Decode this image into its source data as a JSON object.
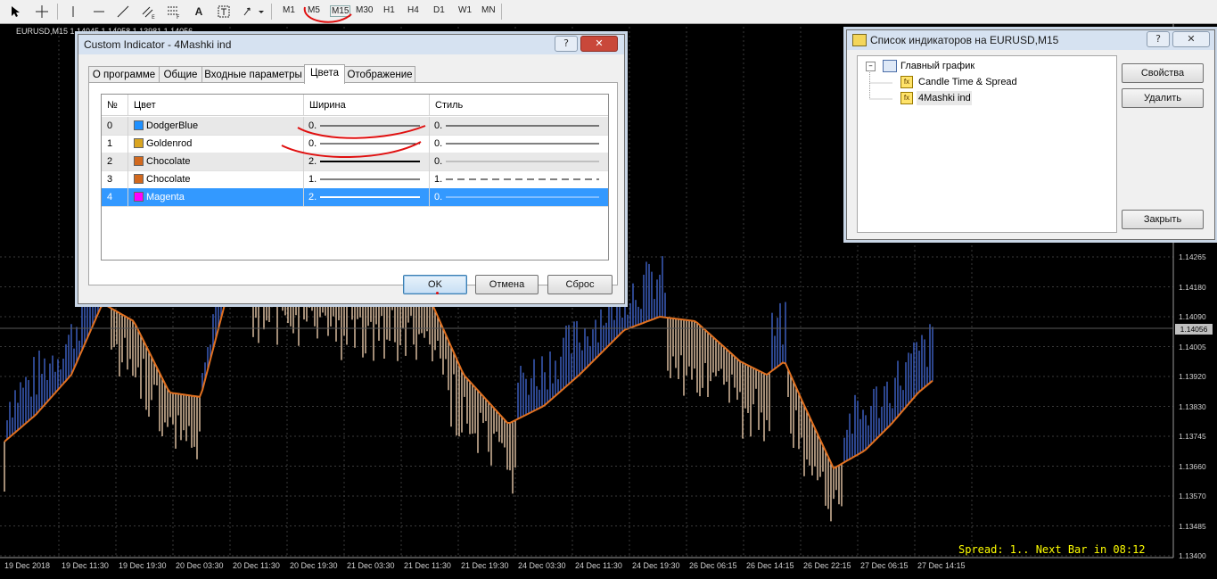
{
  "toolbar": {
    "timeframes": [
      "M1",
      "M5",
      "M15",
      "M30",
      "H1",
      "H4",
      "D1",
      "W1",
      "MN"
    ]
  },
  "chart": {
    "symbol_label": "EURUSD,M15  1.14045 1.14058 1.13981 1.14056",
    "price_ticks": [
      "1.14265",
      "1.14180",
      "1.14090",
      "1.14005",
      "1.13920",
      "1.13830",
      "1.13745",
      "1.13660",
      "1.13570",
      "1.13485",
      "1.13400"
    ],
    "current_price": "1.14056",
    "time_ticks": [
      "19 Dec 2018",
      "19 Dec 11:30",
      "19 Dec 19:30",
      "20 Dec 03:30",
      "20 Dec 11:30",
      "20 Dec 19:30",
      "21 Dec 03:30",
      "21 Dec 11:30",
      "21 Dec 19:30",
      "24 Dec 03:30",
      "24 Dec 11:30",
      "24 Dec 19:30",
      "26 Dec 06:15",
      "26 Dec 14:15",
      "26 Dec 22:15",
      "27 Dec 06:15",
      "27 Dec 14:15"
    ],
    "spread_text": "Spread: 1.. Next Bar in 08:12",
    "colors": {
      "up_bar": "#3f63c8",
      "down_bar": "#e8c9a8",
      "ma_line": "#e07020",
      "grid": "#3a3a3a"
    }
  },
  "indicator_dialog": {
    "title": "Custom Indicator - 4Mashki ind",
    "help_btn": "?",
    "tabs": [
      "О программе",
      "Общие",
      "Входные параметры",
      "Цвета",
      "Отображение"
    ],
    "active_tab": "Цвета",
    "columns": [
      "№",
      "Цвет",
      "Ширина",
      "Стиль"
    ],
    "rows": [
      {
        "num": "0",
        "color_name": "DodgerBlue",
        "color": "#1e90ff",
        "width": "0.",
        "style": "0."
      },
      {
        "num": "1",
        "color_name": "Goldenrod",
        "color": "#daa520",
        "width": "0.",
        "style": "0."
      },
      {
        "num": "2",
        "color_name": "Chocolate",
        "color": "#d2691e",
        "width": "2.",
        "style": "0."
      },
      {
        "num": "3",
        "color_name": "Chocolate",
        "color": "#d2691e",
        "width": "1.",
        "style": "1."
      },
      {
        "num": "4",
        "color_name": "Magenta",
        "color": "#ff00ff",
        "width": "2.",
        "style": "0."
      }
    ],
    "ok_label": "OK",
    "cancel_label": "Отмена",
    "reset_label": "Сброс"
  },
  "list_dialog": {
    "title": "Список индикаторов на EURUSD,M15",
    "help_btn": "?",
    "tree": {
      "root": "Главный график",
      "children": [
        "Candle Time & Spread",
        "4Mashki ind"
      ]
    },
    "properties_label": "Свойства",
    "delete_label": "Удалить",
    "close_label": "Закрыть"
  }
}
